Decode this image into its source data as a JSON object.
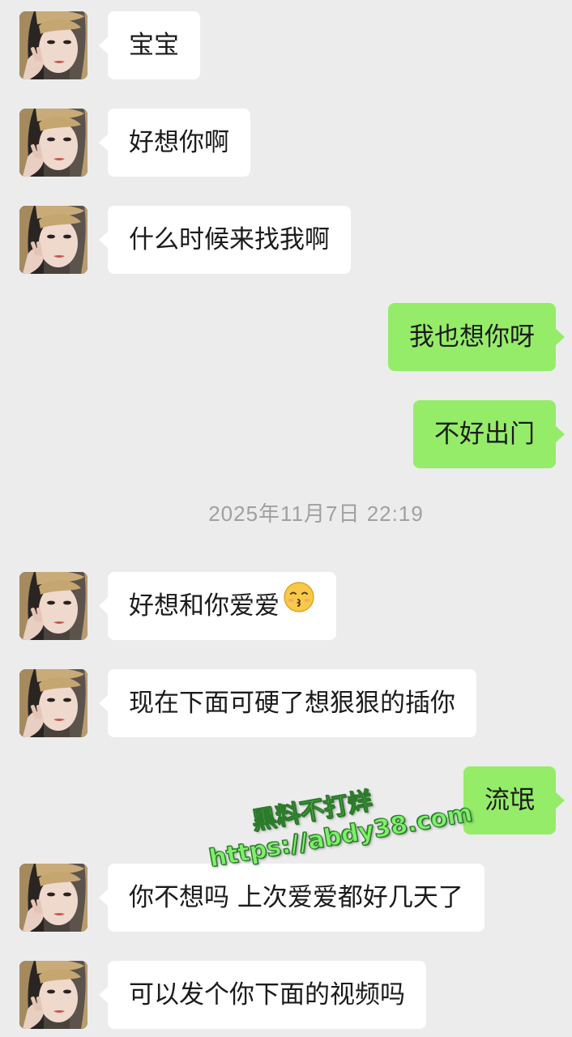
{
  "chat": {
    "messages": [
      {
        "id": "m1",
        "text": "宝宝"
      },
      {
        "id": "m2",
        "text": "好想你啊"
      },
      {
        "id": "m3",
        "text": "什么时候来找我啊"
      },
      {
        "id": "m4",
        "text": "我也想你呀"
      },
      {
        "id": "m5",
        "text": "不好出门"
      },
      {
        "id": "m6",
        "text": "好想和你爱爱",
        "emoji": "kissing-face-emoji"
      },
      {
        "id": "m7",
        "text": "现在下面可硬了想狠狠的插你"
      },
      {
        "id": "m8",
        "text": "流氓"
      },
      {
        "id": "m9",
        "text": "你不想吗 上次爱爱都好几天了"
      },
      {
        "id": "m10",
        "text": "可以发个你下面的视频吗"
      }
    ],
    "timestamp": "2025年11月7日 22:19"
  },
  "watermark": {
    "line1": "黑料不打烊",
    "line2": "https://abdy38.com"
  },
  "colors": {
    "background": "#ececec",
    "incoming_bubble": "#ffffff",
    "outgoing_bubble": "#95ec69",
    "timestamp_text": "#a0a0a0",
    "watermark": "#7ef06a"
  },
  "icons": {
    "avatar": "contact-avatar",
    "emoji": "kissing-face-emoji"
  }
}
